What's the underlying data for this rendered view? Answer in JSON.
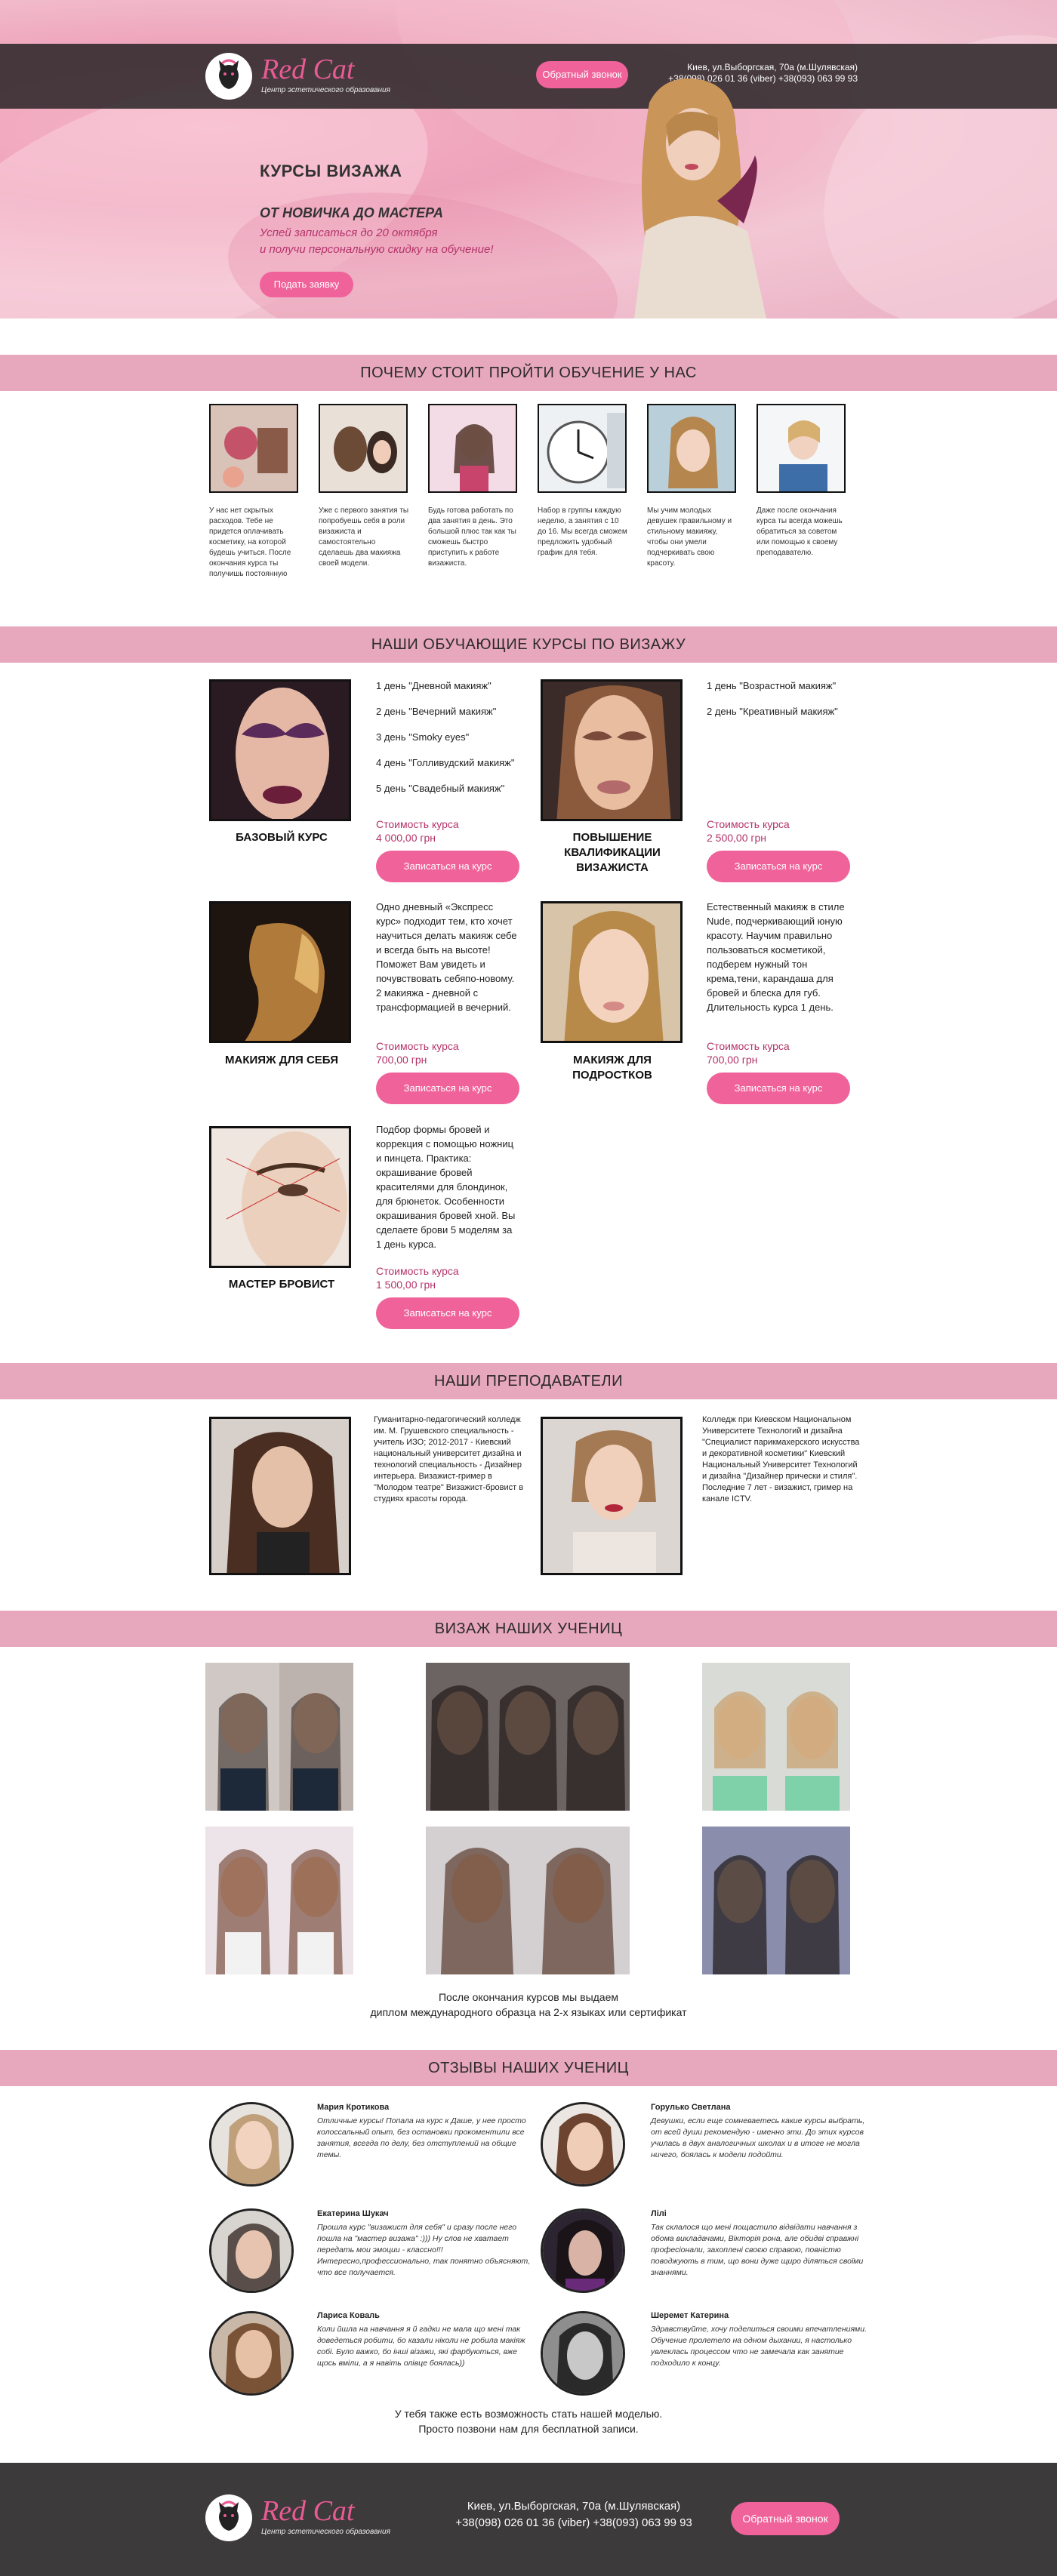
{
  "brand": {
    "name": "Red Cat",
    "subtitle": "Центр эстетического образования"
  },
  "header": {
    "call_button": "Обратный звонок",
    "address": "Киев, ул.Выборгская, 70а   (м.Шулявская)",
    "phones": "+38(098) 026 01 36 (viber) +38(093) 063 99 93"
  },
  "hero": {
    "title": "КУРСЫ ВИЗАЖА",
    "subtitle": "ОТ НОВИЧКА ДО МАСТЕРА",
    "line1": "Успей записаться до 20 октября",
    "line2": "и получи персональную скидку на обучение!",
    "button": "Подать заявку"
  },
  "why": {
    "title": "ПОЧЕМУ СТОИТ ПРОЙТИ ОБУЧЕНИЕ У НАС",
    "items": [
      {
        "text": "У нас нет скрытых расходов. Тебе не придется оплачивать косметику, на которой будешь учиться. После окончания курса ты получишь постоянную"
      },
      {
        "text": "Уже с первого занятия ты попробуешь себя в роли визажиста и самостоятельно сделаешь два макияжа своей модели."
      },
      {
        "text": "Будь готова работать по два занятия в день. Это большой плюс так как ты сможешь быстро приступить к работе визажиста."
      },
      {
        "text": "Набор в группы каждую неделю, а занятия с 10 до 16. Мы всегда сможем предложить удобный график для тебя."
      },
      {
        "text": "Мы учим молодых девушек правильному и стильному макияжу, чтобы они умели подчеркивать свою красоту."
      },
      {
        "text": "Даже после окончания курса ты всегда можешь обратиться за советом или помощью к своему преподавателю."
      }
    ]
  },
  "courses": {
    "title": "НАШИ ОБУЧАЮЩИЕ КУРСЫ ПО ВИЗАЖУ",
    "price_label": "Стоимость курса",
    "enroll_label": "Записаться на курс",
    "basic": {
      "name": "БАЗОВЫЙ КУРС",
      "days": [
        "1 день \"Дневной макияж\"",
        "2 день \"Вечерний макияж\"",
        "3 день \"Smoky eyes\"",
        "4 день \"Голливудский макияж\"",
        "5 день \"Свадебный макияж\""
      ],
      "price": "4 000,00 грн"
    },
    "pro": {
      "name": "ПОВЫШЕНИЕ КВАЛИФИКАЦИИ ВИЗАЖИСТА",
      "days": [
        "1 день \"Возрастной макияж\"",
        "2 день \"Креативный макияж\""
      ],
      "price": "2 500,00 грн"
    },
    "self": {
      "name": "МАКИЯЖ ДЛЯ СЕБЯ",
      "desc": "Одно дневный «Экспресс курс» подходит тем, кто хочет научиться делать макияж себе и всегда быть на высоте! Поможет Вам увидеть и почувствовать себяпо-новому. 2 макияжа - дневной с трансформацией в вечерний.",
      "price": "700,00 грн"
    },
    "teen": {
      "name": "МАКИЯЖ ДЛЯ ПОДРОСТКОВ",
      "desc": "Естественный макияж в стиле Nude, подчеркивающий юную красоту. Научим правильно пользоваться косметикой, подберем нужный тон крема,тени, карандаша для бровей и блеска для губ. Длительность курса 1 день.",
      "price": "700,00 грн"
    },
    "brow": {
      "name": "МАСТЕР БРОВИСТ",
      "desc": "Подбор формы бровей и коррекция с помощью ножниц и пинцета. Практика: окрашивание бровей красителями для блондинок, для брюнеток. Особенности окрашивания бровей хной. Вы сделаете брови 5 моделям за 1 день курса.",
      "price": "1 500,00 грн"
    }
  },
  "teachers": {
    "title": "НАШИ ПРЕПОДАВАТЕЛИ",
    "t1": "Гуманитарно-педагогический колледж им. М. Грушевского специальность - учитель ИЗО; 2012-2017 - Киевский национальный университет дизайна и технологий специальность - Дизайнер интерьера. Визажист-гример в \"Молодом театре\" Визажист-бровист в студиях красоты города.",
    "t2": "Колледж при Киевском Национальном Университете Технологий и дизайна \"Специалист парикмахерского искусства и декоративной косметики\" Киевский Национальный Университет Технологий и дизайна \"Дизайнер прически и стиля\". Последние 7 лет - визажист, гример на канале ICTV."
  },
  "gallery": {
    "title": "ВИЗАЖ НАШИХ УЧЕНИЦ",
    "caption1": "После окончания курсов мы выдаем",
    "caption2": "диплом международного образца на 2-х языках  или сертификат"
  },
  "reviews": {
    "title": "ОТЗЫВЫ НАШИХ УЧЕНИЦ",
    "items": [
      {
        "name": "Мария Кротикова",
        "text": "Отличные курсы! Попала на курс к Даше, у нее просто колоссальный опыт, без остановки прокоментили все занятия, всегда по делу, без отступлений на общие темы."
      },
      {
        "name": "Горулько Светлана",
        "text": "Девушки, если еще сомневаетесь какие курсы выбрать, от всей души рекомендую - именно эти. До этих курсов училась в двух аналогичных школах и в итоге не могла ничего, боялась к модели подойти."
      },
      {
        "name": "Екатерина Шукач",
        "text": "Прошла курс \"визажист для себя\" и сразу после него пошла на \"мастер визажа\" :))) Ну слов не хватает передать мои эмоции - классно!!! Интересно,профессионально, так понятно объясняют, что все получается."
      },
      {
        "name": "Лілі",
        "text": "Так склалося що мені пощастило відвідати навчання з обома викладачами, Вікторія рона, але обидві справжні професіонали, захоплені своєю справою, повністю поводжують в тим, що вони дуже щиро діляться своїми знаннями."
      },
      {
        "name": "Лариса Коваль",
        "text": "Коли йшла на навчання я й гадки не мала що мені так доведеться робити, бо казали ніколи не робила макіяж собі. Було важко, бо інші візажи, які фарбуються, вже щось вміли, а я навіть олівце боялась))"
      },
      {
        "name": "Шеремет Катерина",
        "text": "Здравствуйте, хочу поделиться своими впечатлениями. Обучение пролетело на одном дыхании, я настолько увлеклась процессом что не замечала как занятие подходило к концу."
      }
    ],
    "foot1": "У тебя также есть возможность стать нашей моделью.",
    "foot2": "Просто позвони нам для бесплатной записи."
  },
  "footer": {
    "address": "Киев, ул.Выборгская, 70а (м.Шулявская)",
    "phones": "+38(098) 026 01 36 (viber) +38(093) 063 99 93",
    "call_button": "Обратный звонок"
  },
  "colors": {
    "accent": "#f0629a",
    "band": "#e7a7bc",
    "price": "#b43369",
    "footer_bg": "#3c3a3b"
  }
}
